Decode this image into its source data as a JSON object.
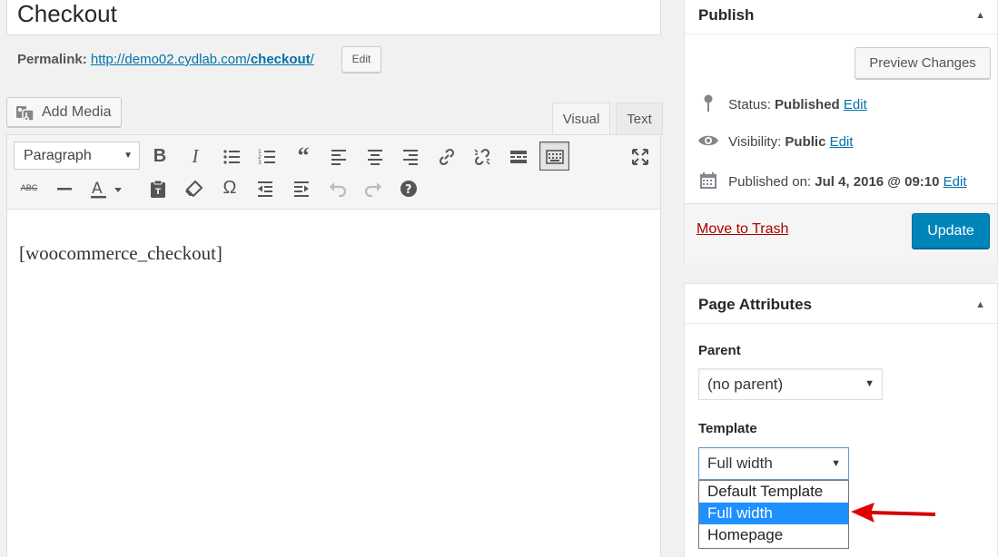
{
  "post": {
    "title": "Checkout",
    "permalink_label": "Permalink:",
    "permalink_url": "http://demo02.cydlab.com/",
    "permalink_slug": "checkout",
    "permalink_trailing": "/",
    "permalink_edit": "Edit"
  },
  "media": {
    "add_media_label": "Add Media"
  },
  "editor": {
    "tabs": {
      "visual": "Visual",
      "text": "Text"
    },
    "format_select": "Paragraph",
    "content": "[woocommerce_checkout]"
  },
  "publish": {
    "title": "Publish",
    "preview_label": "Preview Changes",
    "status_label": "Status:",
    "status_value": "Published",
    "visibility_label": "Visibility:",
    "visibility_value": "Public",
    "published_label": "Published on:",
    "published_value": "Jul 4, 2016 @ 09:10",
    "edit": "Edit",
    "trash_label": "Move to Trash",
    "update_label": "Update"
  },
  "page_attributes": {
    "title": "Page Attributes",
    "parent_label": "Parent",
    "parent_value": "(no parent)",
    "template_label": "Template",
    "template_value": "Full width",
    "template_options": [
      "Default Template",
      "Full width",
      "Homepage"
    ],
    "highlighted_option": "Full width"
  },
  "colors": {
    "accent": "#0085ba",
    "link": "#0073aa",
    "trash": "#a00",
    "highlight": "#1e90ff",
    "arrow": "#e00000"
  }
}
